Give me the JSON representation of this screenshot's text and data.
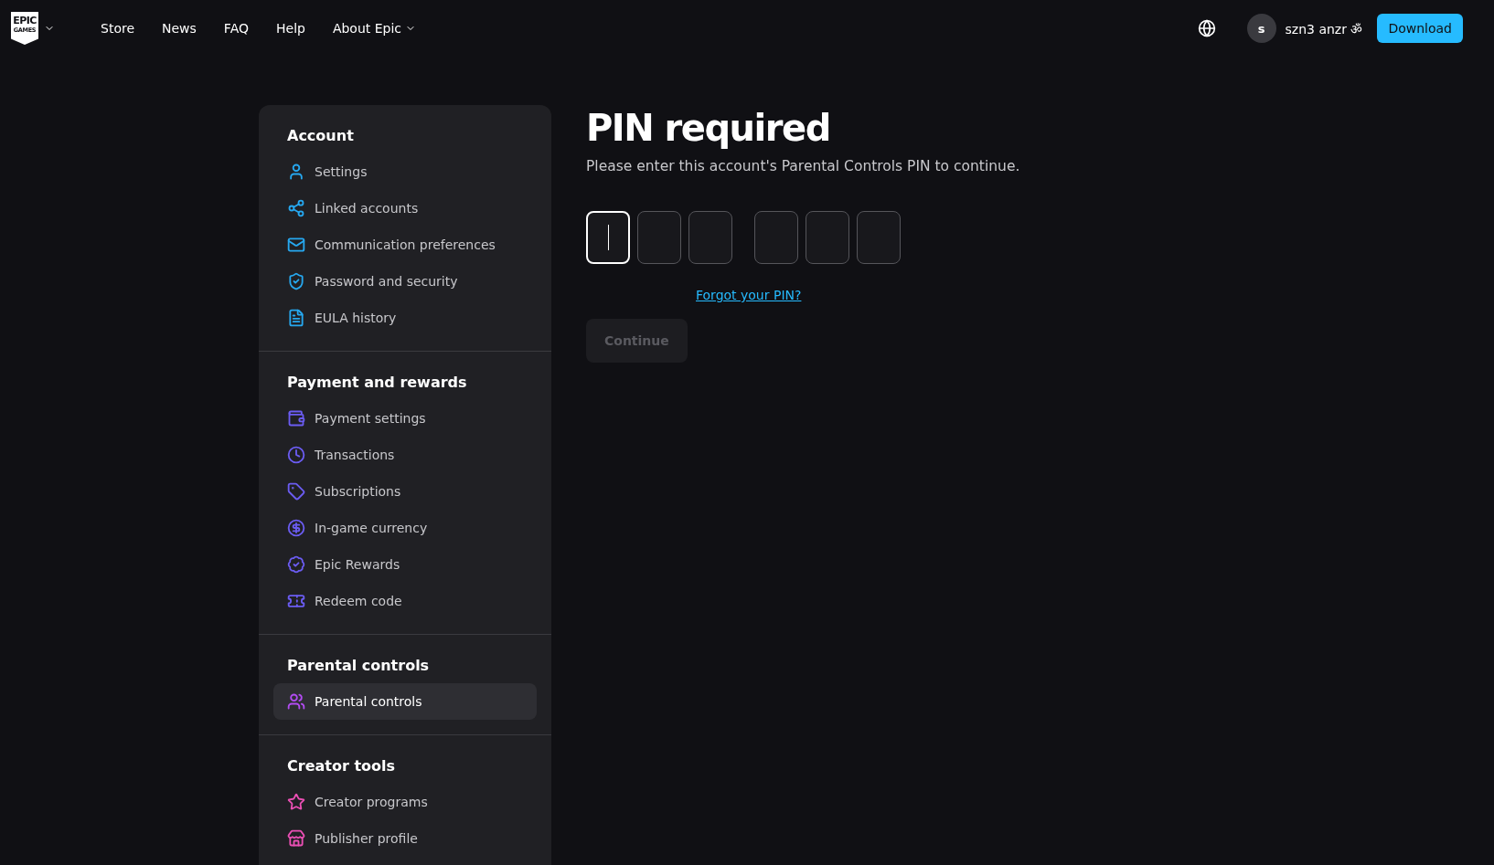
{
  "header": {
    "logo": {
      "line1": "EPIC",
      "line2": "GAMES"
    },
    "nav": [
      {
        "label": "Store",
        "dropdown": false
      },
      {
        "label": "News",
        "dropdown": false
      },
      {
        "label": "FAQ",
        "dropdown": false
      },
      {
        "label": "Help",
        "dropdown": false
      },
      {
        "label": "About Epic",
        "dropdown": true
      }
    ],
    "user": {
      "initial": "s",
      "name": "szn3 anzr ॐ"
    },
    "download": "Download"
  },
  "sidebar": [
    {
      "title": "Account",
      "color": "#26a8f0",
      "items": [
        {
          "label": "Settings",
          "selected": false
        },
        {
          "label": "Linked accounts",
          "selected": false
        },
        {
          "label": "Communication preferences",
          "selected": false
        },
        {
          "label": "Password and security",
          "selected": false
        },
        {
          "label": "EULA history",
          "selected": false
        }
      ]
    },
    {
      "title": "Payment and rewards",
      "color": "#6b5cf2",
      "items": [
        {
          "label": "Payment settings",
          "selected": false
        },
        {
          "label": "Transactions",
          "selected": false
        },
        {
          "label": "Subscriptions",
          "selected": false
        },
        {
          "label": "In-game currency",
          "selected": false
        },
        {
          "label": "Epic Rewards",
          "selected": false
        },
        {
          "label": "Redeem code",
          "selected": false
        }
      ]
    },
    {
      "title": "Parental controls",
      "color": "#b24cf2",
      "items": [
        {
          "label": "Parental controls",
          "selected": true
        }
      ]
    },
    {
      "title": "Creator tools",
      "color": "#ea4fb4",
      "items": [
        {
          "label": "Creator programs",
          "selected": false
        },
        {
          "label": "Publisher profile",
          "selected": false
        }
      ]
    }
  ],
  "main": {
    "title": "PIN required",
    "subtitle": "Please enter this account's Parental Controls PIN to continue.",
    "pin": [
      [
        {
          "focused": true
        },
        {
          "focused": false
        },
        {
          "focused": false
        }
      ],
      [
        {
          "focused": false
        },
        {
          "focused": false
        },
        {
          "focused": false
        }
      ]
    ],
    "forgot": "Forgot your PIN?",
    "continue": {
      "label": "Continue",
      "disabled": true
    }
  }
}
